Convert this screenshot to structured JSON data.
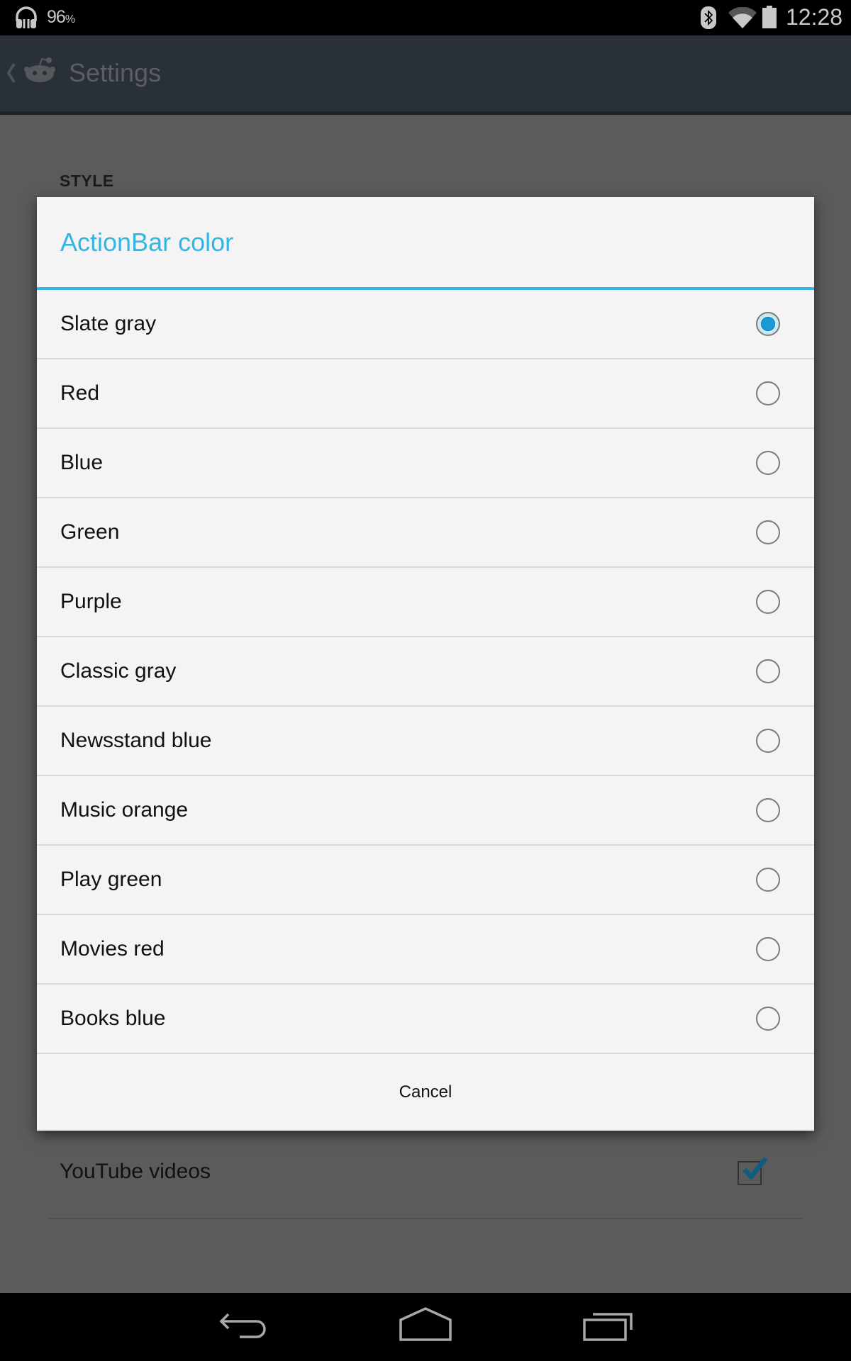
{
  "status_bar": {
    "battery_percent": "96",
    "battery_percent_sign": "%",
    "time": "12:28",
    "icons": [
      "headphones-icon",
      "bluetooth-icon",
      "wifi-icon",
      "battery-icon"
    ]
  },
  "action_bar": {
    "title": "Settings",
    "icons": [
      "up-caret-icon",
      "reddit-alien-icon"
    ]
  },
  "background": {
    "category": "STYLE",
    "pref_row": {
      "label": "YouTube videos",
      "checked": true
    }
  },
  "dialog": {
    "title": "ActionBar color",
    "accent_color": "#33b5e5",
    "selected": "Slate gray",
    "options": [
      {
        "label": "Slate gray",
        "checked": true
      },
      {
        "label": "Red",
        "checked": false
      },
      {
        "label": "Blue",
        "checked": false
      },
      {
        "label": "Green",
        "checked": false
      },
      {
        "label": "Purple",
        "checked": false
      },
      {
        "label": "Classic gray",
        "checked": false
      },
      {
        "label": "Newsstand blue",
        "checked": false
      },
      {
        "label": "Music orange",
        "checked": false
      },
      {
        "label": "Play green",
        "checked": false
      },
      {
        "label": "Movies red",
        "checked": false
      },
      {
        "label": "Books blue",
        "checked": false
      }
    ],
    "cancel_label": "Cancel"
  },
  "nav_bar": {
    "buttons": [
      "back-icon",
      "home-icon",
      "recent-apps-icon"
    ]
  }
}
